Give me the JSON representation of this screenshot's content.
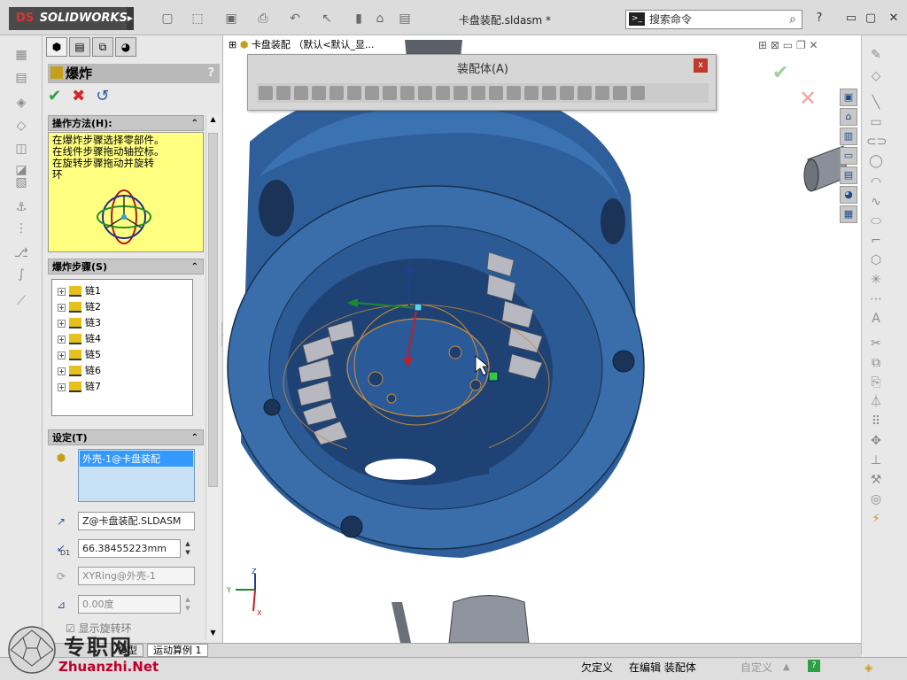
{
  "app": {
    "logo_text": "SOLIDWORKS",
    "logo_mark": "DS",
    "document_title": "卡盘装配.sldasm *",
    "search_placeholder": "搜索命令"
  },
  "tree": {
    "root_label": "卡盘装配 （默认<默认_显..."
  },
  "property_manager": {
    "title": "爆炸",
    "help": "?",
    "ok_icon": "check-icon",
    "cancel_icon": "x-icon",
    "undo_icon": "undo-icon",
    "howto": {
      "header": "操作方法(H):",
      "lines": [
        "在爆炸步骤选择零部件。",
        "在线件步骤拖动轴控标。",
        "在旋转步骤拖动并旋转",
        "环"
      ]
    },
    "steps": {
      "header": "爆炸步骤(S)",
      "items": [
        "链1",
        "链2",
        "链3",
        "链4",
        "链5",
        "链6",
        "链7"
      ]
    },
    "settings": {
      "header": "设定(T)",
      "selected_component": "外壳-1@卡盘装配",
      "direction": "Z@卡盘装配.SLDASM",
      "distance": "66.38455223mm",
      "distance_label": "D1",
      "rotation_axis": "XYRing@外壳-1",
      "angle": "0.00度",
      "show_rotation_ring": "显示旋转环"
    }
  },
  "floating_toolbar": {
    "title": "装配体(A)",
    "close": "x"
  },
  "bottom_tabs": [
    "模型",
    "运动算例 1"
  ],
  "status": {
    "under_defined": "欠定义",
    "editing": "在编辑 装配体",
    "custom": "自定义"
  },
  "triad": {
    "x": "X",
    "y": "Y",
    "z": "Z"
  },
  "watermark": {
    "text": "专职网",
    "url": "Zhuanzhi.Net"
  },
  "colors": {
    "part_blue": "#3a6eaa",
    "part_dark": "#1d3f70",
    "gear_gray": "#b8b8c0",
    "howto_bg": "#ffff80",
    "ok_green": "#2ea043",
    "cancel_red": "#d22",
    "selection_blue": "#3399ff",
    "status_bar": "#dedede"
  }
}
